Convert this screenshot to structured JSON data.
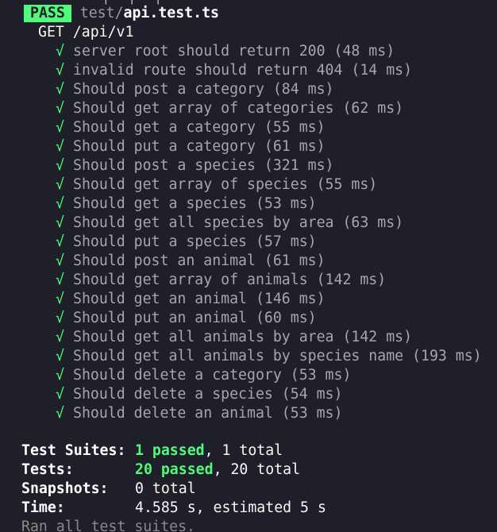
{
  "header": {
    "top_fragment": "│  │  │",
    "status_badge": "PASS",
    "suite_dir": "test/",
    "suite_file": "api.test.ts",
    "describe": "GET /api/v1"
  },
  "check_glyph": "√",
  "tests": [
    "server root should return 200 (48 ms)",
    "invalid route should return 404 (14 ms)",
    "Should post a category (84 ms)",
    "Should get array of categories (62 ms)",
    "Should get a category (55 ms)",
    "Should put a category (61 ms)",
    "Should post a species (321 ms)",
    "Should get array of species (55 ms)",
    "Should get a species (53 ms)",
    "Should get all species by area (63 ms)",
    "Should put a species (57 ms)",
    "Should post an animal (61 ms)",
    "Should get array of animals (142 ms)",
    "Should get an animal (146 ms)",
    "Should put an animal (60 ms)",
    "Should get all animals by area (142 ms)",
    "Should get all animals by species name (193 ms)",
    "Should delete a category (53 ms)",
    "Should delete a species (54 ms)",
    "Should delete an animal (53 ms)"
  ],
  "summary": {
    "suites_label": "Test Suites:",
    "suites_passed": "1 passed",
    "suites_rest": ", 1 total",
    "tests_label": "Tests:",
    "tests_passed": "20 passed",
    "tests_rest": ", 20 total",
    "snapshots_label": "Snapshots:",
    "snapshots_value": "0 total",
    "time_label": "Time:",
    "time_value": "4.585 s, estimated 5 s",
    "footer": "Ran all test suites."
  },
  "colors": {
    "background": "#1e1f29",
    "pass_green": "#50fa7b",
    "test_text": "#a7a7a7"
  }
}
